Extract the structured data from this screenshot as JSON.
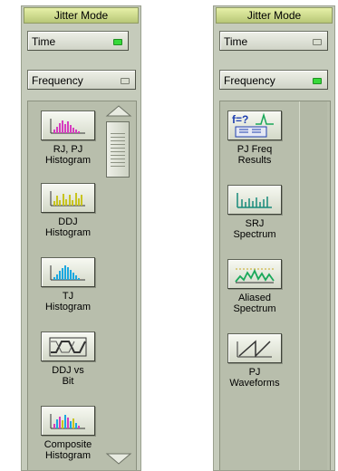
{
  "left_panel": {
    "title": "Jitter Mode",
    "time_label": "Time",
    "time_on": true,
    "frequency_label": "Frequency",
    "frequency_on": false,
    "items": [
      {
        "line1": "RJ, PJ",
        "line2": "Histogram",
        "icon": "rj-pj-histogram-icon"
      },
      {
        "line1": "DDJ",
        "line2": "Histogram",
        "icon": "ddj-histogram-icon"
      },
      {
        "line1": "TJ",
        "line2": "Histogram",
        "icon": "tj-histogram-icon"
      },
      {
        "line1": "DDJ vs",
        "line2": "Bit",
        "icon": "ddj-vs-bit-icon"
      },
      {
        "line1": "Composite",
        "line2": "Histogram",
        "icon": "composite-histogram-icon"
      }
    ]
  },
  "right_panel": {
    "title": "Jitter Mode",
    "time_label": "Time",
    "time_on": false,
    "frequency_label": "Frequency",
    "frequency_on": true,
    "items": [
      {
        "line1": "PJ Freq",
        "line2": "Results",
        "icon": "pj-freq-results-icon"
      },
      {
        "line1": "SRJ",
        "line2": "Spectrum",
        "icon": "srj-spectrum-icon"
      },
      {
        "line1": "Aliased",
        "line2": "Spectrum",
        "icon": "aliased-spectrum-icon"
      },
      {
        "line1": "PJ",
        "line2": "Waveforms",
        "icon": "pj-waveforms-icon"
      }
    ]
  },
  "colors": {
    "panel_bg": "#c5cbbb",
    "title_green": "#d2dc8e",
    "led_on": "#37d93a",
    "histogram_magenta": "#d63cc0",
    "histogram_yellow": "#c8c41e",
    "histogram_cyan": "#1aa8e0",
    "spectrum_teal": "#178a7a"
  }
}
